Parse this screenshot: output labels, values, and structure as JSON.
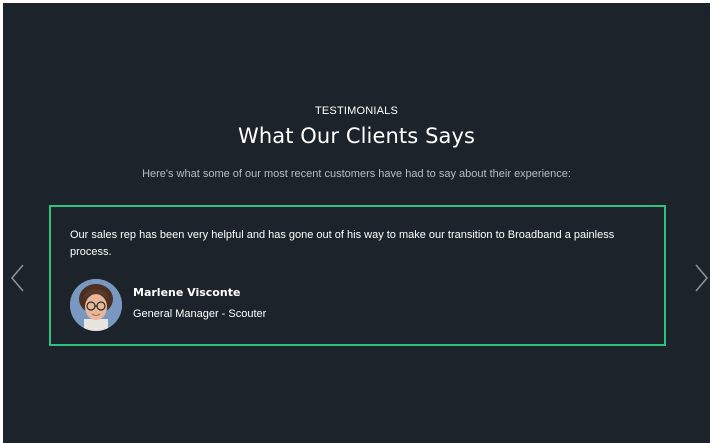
{
  "section": {
    "eyebrow": "TESTIMONIALS",
    "title": "What Our Clients Says",
    "subtitle": "Here's what some of our most recent customers have had to say about their experience:"
  },
  "testimonial": {
    "quote": "Our sales rep has been very helpful and has gone out of his way to make our transition to Broadband a painless process.",
    "name": "Marlene Visconte",
    "role": "General Manager - Scouter"
  },
  "navigation": {
    "prev_icon": "chevron-left-icon",
    "next_icon": "chevron-right-icon"
  },
  "colors": {
    "background": "#1c232b",
    "card_border": "#2ec27e",
    "text": "#ffffff",
    "muted_text": "#b7bdc4"
  }
}
